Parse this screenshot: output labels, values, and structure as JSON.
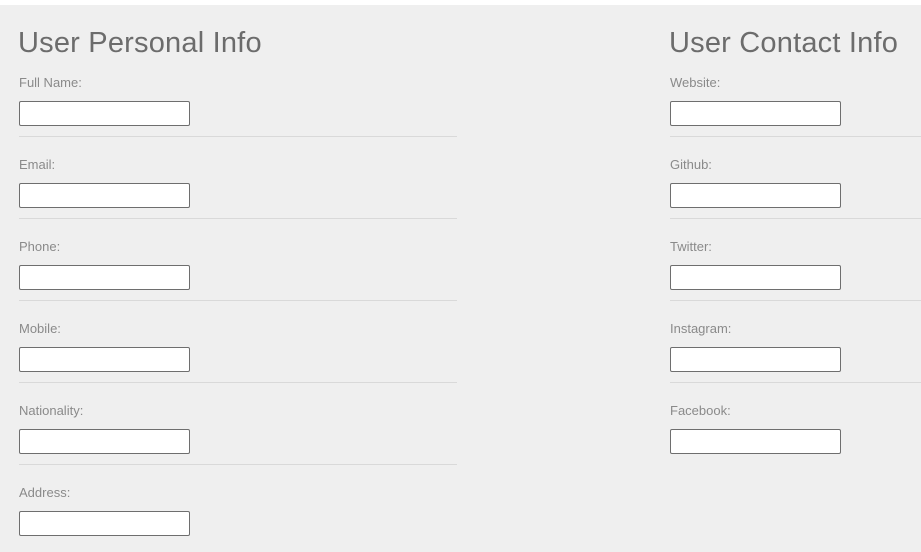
{
  "personal": {
    "title": "User Personal Info",
    "fields": [
      {
        "label": "Full Name:",
        "value": "",
        "placeholder": ""
      },
      {
        "label": "Email:",
        "value": "",
        "placeholder": ""
      },
      {
        "label": "Phone:",
        "value": "",
        "placeholder": ""
      },
      {
        "label": "Mobile:",
        "value": "",
        "placeholder": ""
      },
      {
        "label": "Nationality:",
        "value": "",
        "placeholder": ""
      },
      {
        "label": "Address:",
        "value": "",
        "placeholder": ""
      }
    ]
  },
  "contact": {
    "title": "User Contact Info",
    "fields": [
      {
        "label": "Website:",
        "value": "",
        "placeholder": ""
      },
      {
        "label": "Github:",
        "value": "",
        "placeholder": ""
      },
      {
        "label": "Twitter:",
        "value": "",
        "placeholder": ""
      },
      {
        "label": "Instagram:",
        "value": "",
        "placeholder": ""
      },
      {
        "label": "Facebook:",
        "value": "",
        "placeholder": ""
      }
    ]
  }
}
